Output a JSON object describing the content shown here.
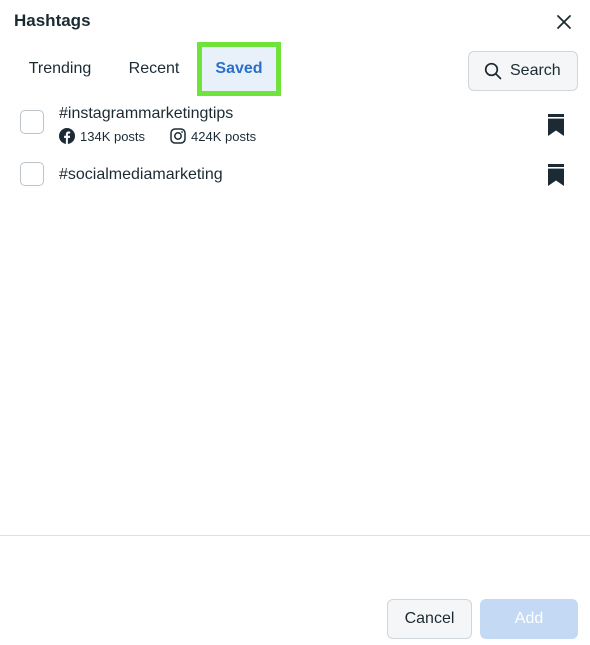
{
  "dialog": {
    "title": "Hashtags"
  },
  "tabs": [
    {
      "label": "Trending",
      "active": false
    },
    {
      "label": "Recent",
      "active": false
    },
    {
      "label": "Saved",
      "active": true
    }
  ],
  "search": {
    "label": "Search",
    "icon": "search-icon"
  },
  "hashtags": [
    {
      "tag": "#instagrammarketingtips",
      "facebook_posts": "134K posts",
      "instagram_posts": "424K posts",
      "checked": false,
      "saved": true
    },
    {
      "tag": "#socialmediamarketing",
      "checked": false,
      "saved": true
    }
  ],
  "footer": {
    "cancel_label": "Cancel",
    "add_label": "Add"
  },
  "colors": {
    "accent": "#2a6fc9",
    "highlight_border": "#6fe33a",
    "add_disabled": "#c3d9f4",
    "text": "#1c2b33"
  }
}
